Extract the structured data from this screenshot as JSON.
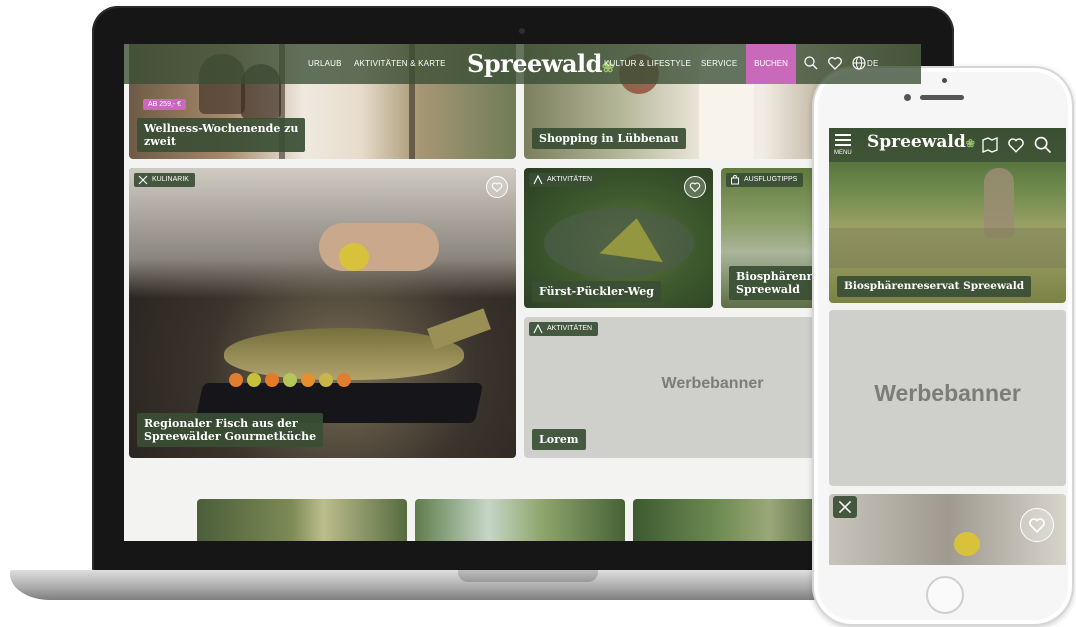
{
  "desktop": {
    "nav": {
      "items": [
        "URLAUB",
        "AKTIVITÄTEN & KARTE",
        "KULTUR & LIFESTYLE",
        "SERVICE"
      ],
      "logo": "Spreewald",
      "book_label": "BUCHEN",
      "lang": "DE"
    },
    "tiles": {
      "wellness": {
        "price": "AB 259,- €",
        "title_line1": "Wellness-Wochenende zu",
        "title_line2": "zweit"
      },
      "shopping": {
        "title": "Shopping in Lübbenau"
      },
      "kulinarik": {
        "tag": "KULINARIK",
        "title_line1": "Regionaler Fisch aus der",
        "title_line2": "Spreewälder Gourmetküche"
      },
      "pueckler": {
        "tag": "AKTIVITÄTEN",
        "title": "Fürst-Pückler-Weg"
      },
      "biosphaere": {
        "tag": "AUSFLUGTIPPS",
        "title_line1": "Biosphärenres",
        "title_line2": "Spreewald"
      },
      "banner": {
        "tag": "AKTIVITÄTEN",
        "text": "Werbebanner",
        "button": "Lorem"
      }
    }
  },
  "mobile": {
    "menu_label": "MENU",
    "logo": "Spreewald",
    "hero_title": "Biosphärenreservat Spreewald",
    "banner_text": "Werbebanner"
  },
  "colors": {
    "brand_green": "#3a4e34",
    "accent_pink": "#c86ab9",
    "banner_grey": "#cfd0cb"
  }
}
